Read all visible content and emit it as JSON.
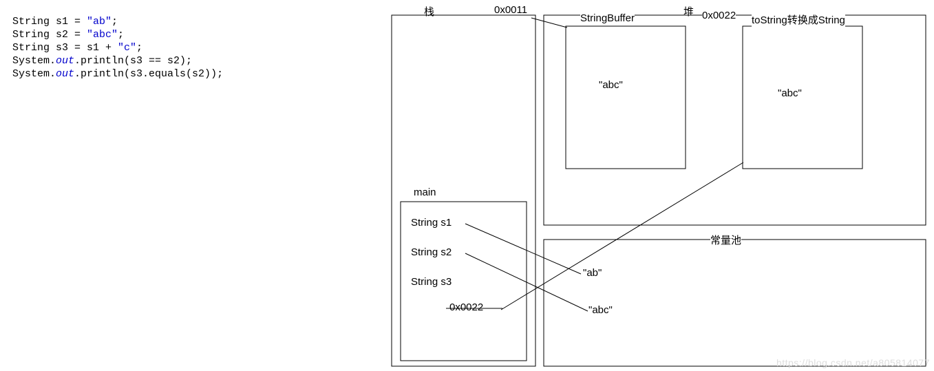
{
  "code": {
    "l1_a": "String s1 = ",
    "l1_b": "\"ab\"",
    "l1_c": ";",
    "l2_a": "String s2 = ",
    "l2_b": "\"abc\"",
    "l2_c": ";",
    "l3_a": "String s3 = s1 + ",
    "l3_b": "\"c\"",
    "l3_c": ";",
    "l4_a": "System.",
    "l4_b": "out",
    "l4_c": ".println(s3 == s2);",
    "l5_a": "System.",
    "l5_b": "out",
    "l5_c": ".println(s3.equals(s2));"
  },
  "labels": {
    "stack": "栈",
    "addr1": "0x0011",
    "stringbuffer": "StringBuffer",
    "heap": "堆",
    "addr2": "0x0022",
    "tostring": "toString转换成String",
    "main": "main",
    "s1": "String s1",
    "s2": "String s2",
    "s3": "String s3",
    "addr2b": "0x0022",
    "abc1": "\"abc\"",
    "abc2": "\"abc\"",
    "pool": "常量池",
    "ab": "\"ab\"",
    "abc3": "\"abc\""
  },
  "watermark": "https://blog.csdn.net/a805814077"
}
